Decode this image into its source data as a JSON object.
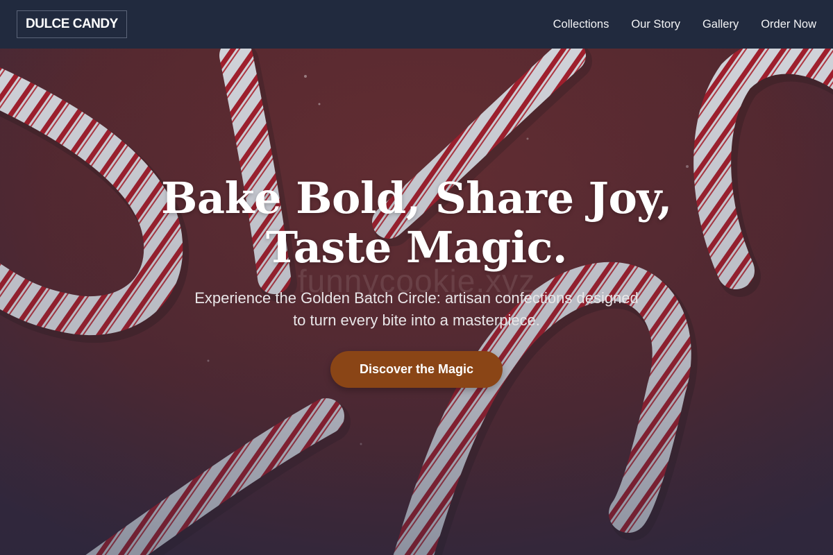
{
  "nav": {
    "brand": "DULCE CANDY",
    "links": [
      {
        "label": "Collections"
      },
      {
        "label": "Our Story"
      },
      {
        "label": "Gallery"
      },
      {
        "label": "Order Now"
      }
    ]
  },
  "hero": {
    "title_line1": "Bake Bold, Share Joy,",
    "title_line2": "Taste Magic.",
    "subtitle": "Experience the Golden Batch Circle: artisan confections designed to turn every bite into a masterpiece.",
    "cta": "Discover the Magic",
    "watermark": "funnycookie.xyz"
  },
  "colors": {
    "navbar": "#212a3e",
    "background": "#6b2c2e",
    "cta": "#8a4516",
    "stripe": "#b3202b"
  }
}
